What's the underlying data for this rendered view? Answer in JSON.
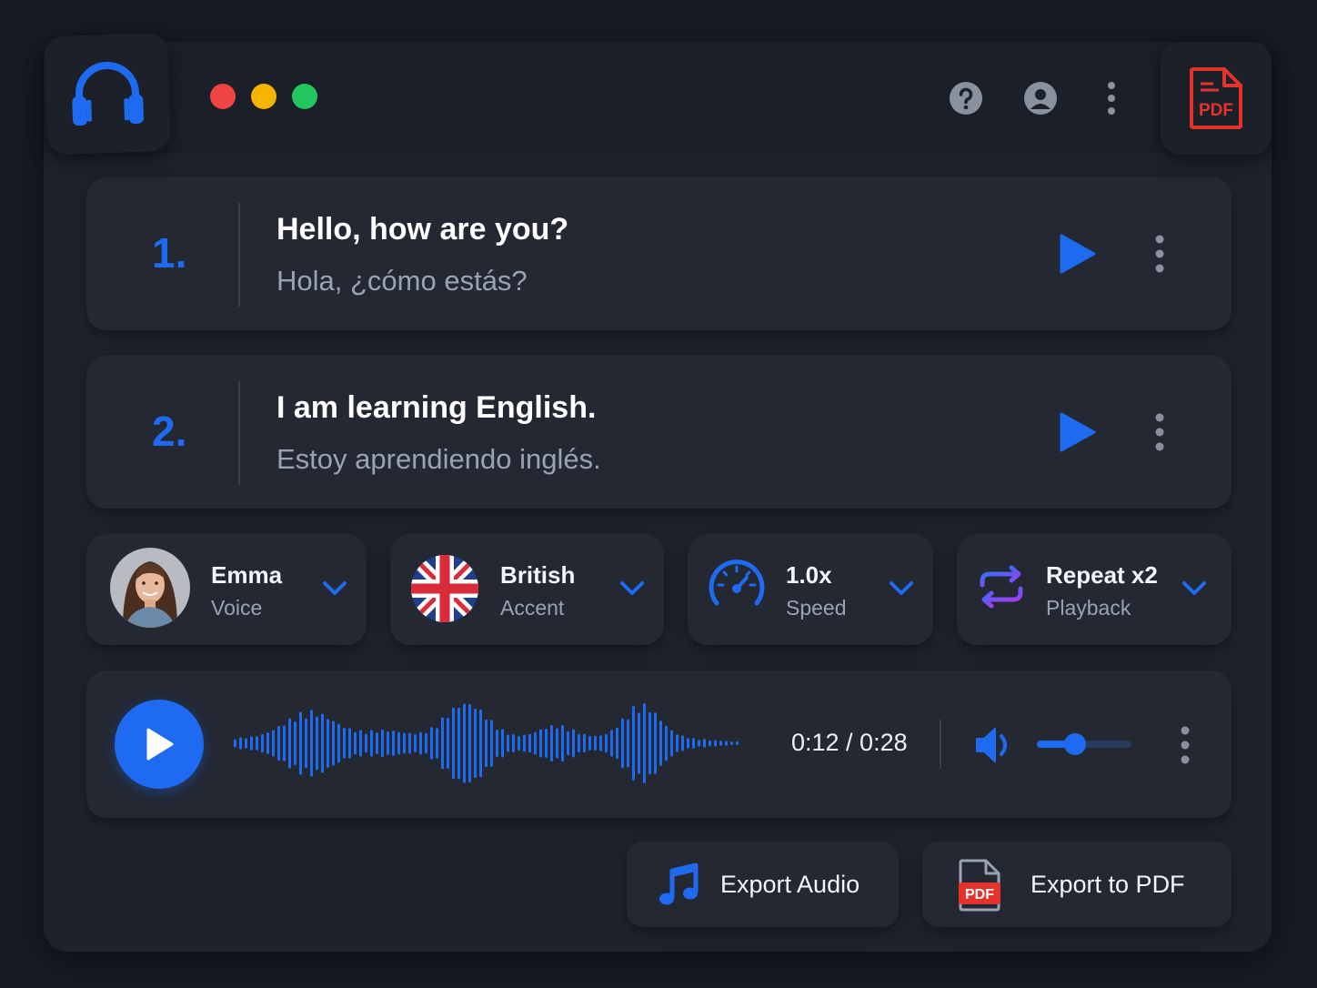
{
  "window": {
    "traffic_colors": [
      "#ef4444",
      "#f5b400",
      "#22c55e"
    ]
  },
  "toolbar": {
    "icons": [
      "help-icon",
      "account-icon",
      "more-vertical-icon"
    ],
    "pdf_badge": "PDF"
  },
  "phrases": [
    {
      "number": "1.",
      "english": "Hello, how are you?",
      "spanish": "Hola, ¿cómo estás?"
    },
    {
      "number": "2.",
      "english": "I am learning English.",
      "spanish": "Estoy aprendiendo inglés."
    }
  ],
  "options": {
    "voice": {
      "title": "Emma",
      "subtitle": "Voice"
    },
    "accent": {
      "title": "British",
      "subtitle": "Accent"
    },
    "speed": {
      "title": "1.0x",
      "subtitle": "Speed"
    },
    "repeat": {
      "title": "Repeat x2",
      "subtitle": "Playback"
    }
  },
  "player": {
    "time": "0:12 / 0:28",
    "volume_level": 0.4
  },
  "actions": {
    "export_audio": "Export Audio",
    "export_pdf": "Export to PDF",
    "pdf_badge": "PDF"
  },
  "colors": {
    "accent": "#1e6bf2",
    "pdf_red": "#e5322d",
    "repeat_purple": "#7c4dff"
  }
}
